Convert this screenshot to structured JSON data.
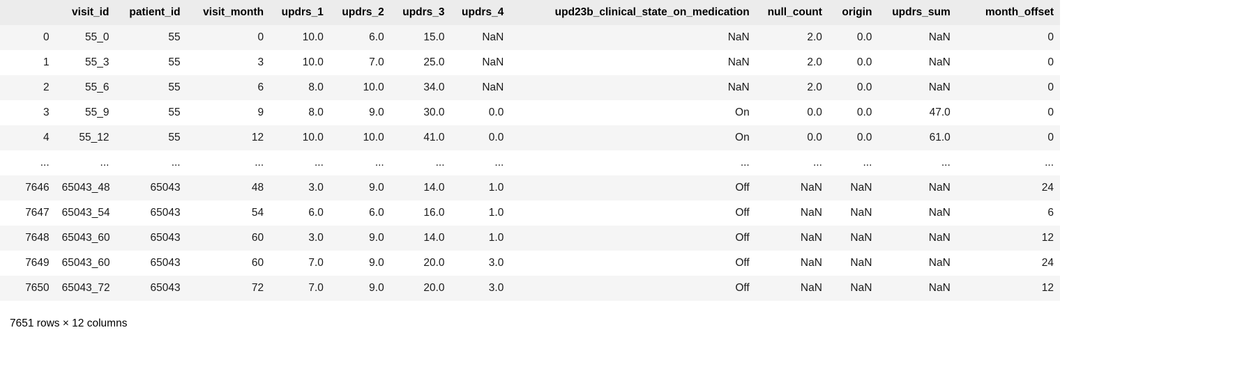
{
  "table": {
    "columns": [
      "",
      "visit_id",
      "patient_id",
      "visit_month",
      "updrs_1",
      "updrs_2",
      "updrs_3",
      "updrs_4",
      "upd23b_clinical_state_on_medication",
      "null_count",
      "origin",
      "updrs_sum",
      "month_offset"
    ],
    "rows": [
      {
        "index": "0",
        "visit_id": "55_0",
        "patient_id": "55",
        "visit_month": "0",
        "updrs_1": "10.0",
        "updrs_2": "6.0",
        "updrs_3": "15.0",
        "updrs_4": "NaN",
        "upd23b_clinical_state_on_medication": "NaN",
        "null_count": "2.0",
        "origin": "0.0",
        "updrs_sum": "NaN",
        "month_offset": "0"
      },
      {
        "index": "1",
        "visit_id": "55_3",
        "patient_id": "55",
        "visit_month": "3",
        "updrs_1": "10.0",
        "updrs_2": "7.0",
        "updrs_3": "25.0",
        "updrs_4": "NaN",
        "upd23b_clinical_state_on_medication": "NaN",
        "null_count": "2.0",
        "origin": "0.0",
        "updrs_sum": "NaN",
        "month_offset": "0"
      },
      {
        "index": "2",
        "visit_id": "55_6",
        "patient_id": "55",
        "visit_month": "6",
        "updrs_1": "8.0",
        "updrs_2": "10.0",
        "updrs_3": "34.0",
        "updrs_4": "NaN",
        "upd23b_clinical_state_on_medication": "NaN",
        "null_count": "2.0",
        "origin": "0.0",
        "updrs_sum": "NaN",
        "month_offset": "0"
      },
      {
        "index": "3",
        "visit_id": "55_9",
        "patient_id": "55",
        "visit_month": "9",
        "updrs_1": "8.0",
        "updrs_2": "9.0",
        "updrs_3": "30.0",
        "updrs_4": "0.0",
        "upd23b_clinical_state_on_medication": "On",
        "null_count": "0.0",
        "origin": "0.0",
        "updrs_sum": "47.0",
        "month_offset": "0"
      },
      {
        "index": "4",
        "visit_id": "55_12",
        "patient_id": "55",
        "visit_month": "12",
        "updrs_1": "10.0",
        "updrs_2": "10.0",
        "updrs_3": "41.0",
        "updrs_4": "0.0",
        "upd23b_clinical_state_on_medication": "On",
        "null_count": "0.0",
        "origin": "0.0",
        "updrs_sum": "61.0",
        "month_offset": "0"
      },
      {
        "index": "...",
        "visit_id": "...",
        "patient_id": "...",
        "visit_month": "...",
        "updrs_1": "...",
        "updrs_2": "...",
        "updrs_3": "...",
        "updrs_4": "...",
        "upd23b_clinical_state_on_medication": "...",
        "null_count": "...",
        "origin": "...",
        "updrs_sum": "...",
        "month_offset": "..."
      },
      {
        "index": "7646",
        "visit_id": "65043_48",
        "patient_id": "65043",
        "visit_month": "48",
        "updrs_1": "3.0",
        "updrs_2": "9.0",
        "updrs_3": "14.0",
        "updrs_4": "1.0",
        "upd23b_clinical_state_on_medication": "Off",
        "null_count": "NaN",
        "origin": "NaN",
        "updrs_sum": "NaN",
        "month_offset": "24"
      },
      {
        "index": "7647",
        "visit_id": "65043_54",
        "patient_id": "65043",
        "visit_month": "54",
        "updrs_1": "6.0",
        "updrs_2": "6.0",
        "updrs_3": "16.0",
        "updrs_4": "1.0",
        "upd23b_clinical_state_on_medication": "Off",
        "null_count": "NaN",
        "origin": "NaN",
        "updrs_sum": "NaN",
        "month_offset": "6"
      },
      {
        "index": "7648",
        "visit_id": "65043_60",
        "patient_id": "65043",
        "visit_month": "60",
        "updrs_1": "3.0",
        "updrs_2": "9.0",
        "updrs_3": "14.0",
        "updrs_4": "1.0",
        "upd23b_clinical_state_on_medication": "Off",
        "null_count": "NaN",
        "origin": "NaN",
        "updrs_sum": "NaN",
        "month_offset": "12"
      },
      {
        "index": "7649",
        "visit_id": "65043_60",
        "patient_id": "65043",
        "visit_month": "60",
        "updrs_1": "7.0",
        "updrs_2": "9.0",
        "updrs_3": "20.0",
        "updrs_4": "3.0",
        "upd23b_clinical_state_on_medication": "Off",
        "null_count": "NaN",
        "origin": "NaN",
        "updrs_sum": "NaN",
        "month_offset": "24"
      },
      {
        "index": "7650",
        "visit_id": "65043_72",
        "patient_id": "65043",
        "visit_month": "72",
        "updrs_1": "7.0",
        "updrs_2": "9.0",
        "updrs_3": "20.0",
        "updrs_4": "3.0",
        "upd23b_clinical_state_on_medication": "Off",
        "null_count": "NaN",
        "origin": "NaN",
        "updrs_sum": "NaN",
        "month_offset": "12"
      }
    ],
    "shape_caption": "7651 rows × 12 columns"
  },
  "colors": {
    "header_background": "#ececec",
    "row_stripe": "#f5f5f5",
    "row_background": "#ffffff",
    "text": "#1a1a1a"
  }
}
